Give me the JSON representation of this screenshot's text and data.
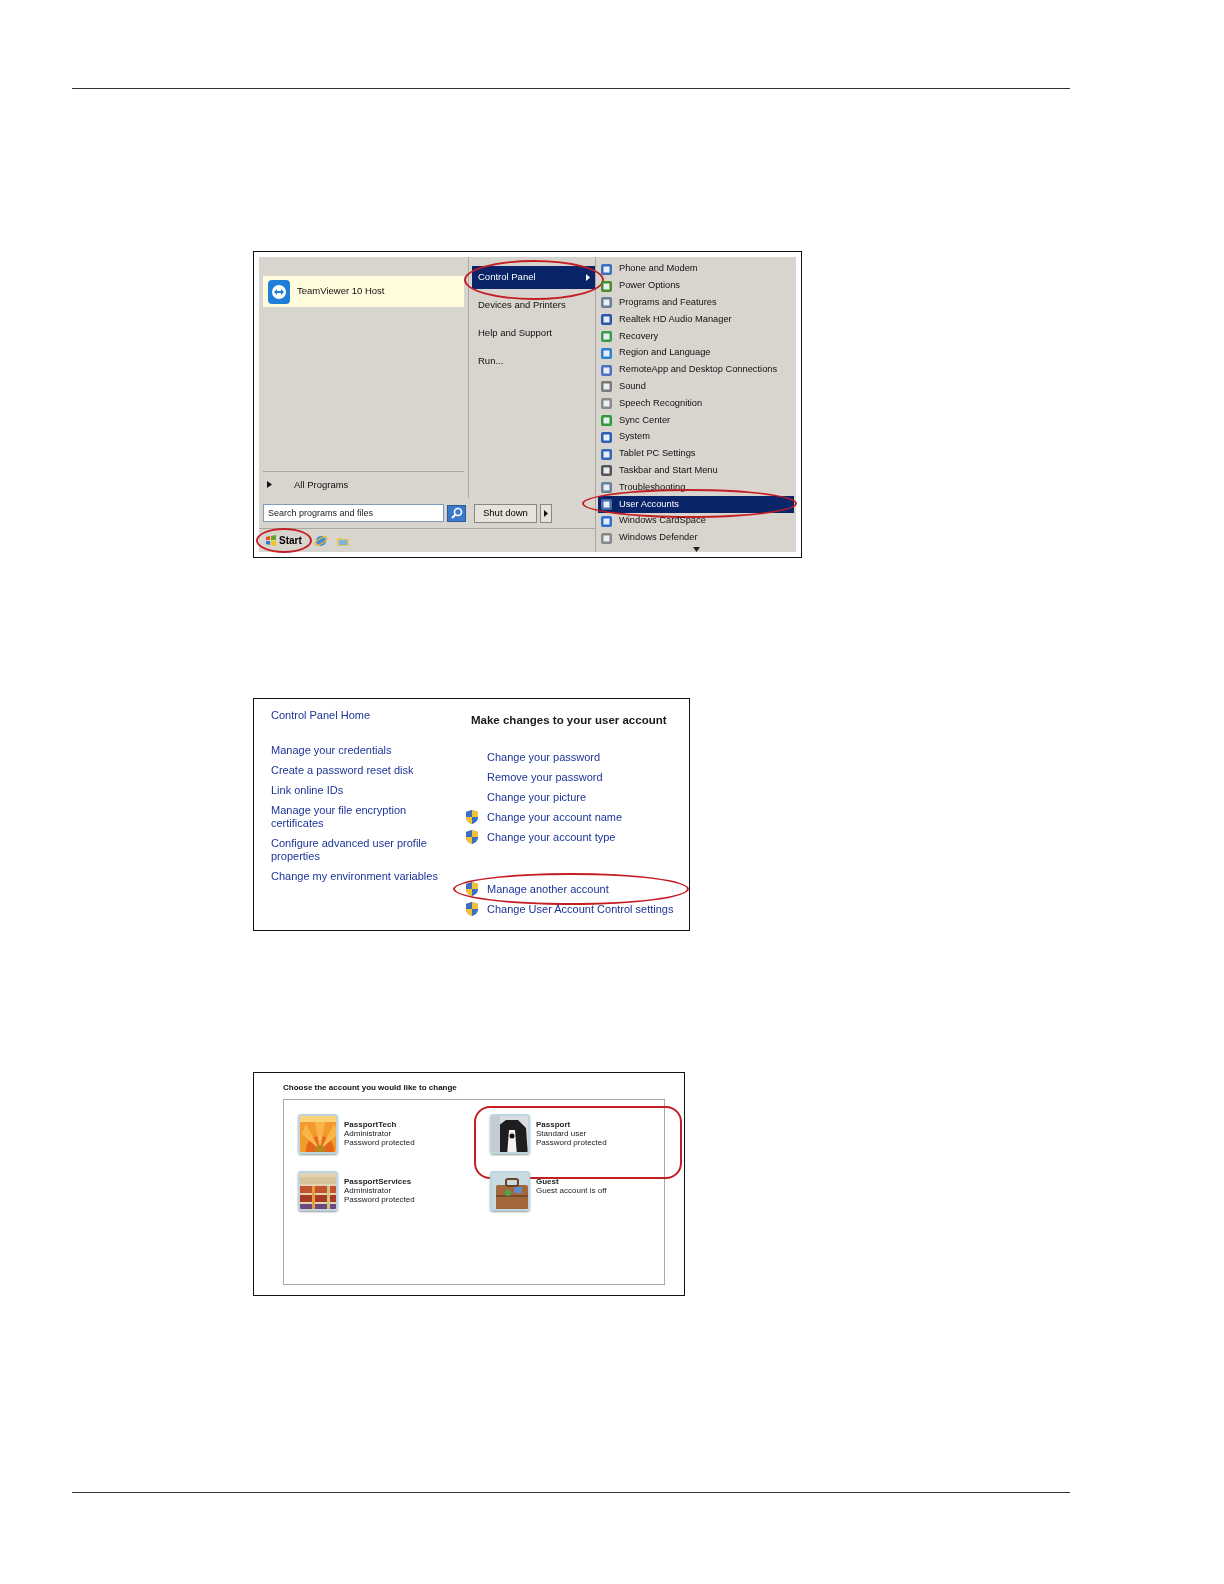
{
  "start_menu": {
    "pinned_programs": [
      {
        "label": "TeamViewer 10 Host"
      }
    ],
    "all_programs": "All Programs",
    "search": {
      "placeholder": "Search programs and files"
    },
    "shutdown": "Shut down",
    "places": [
      {
        "label": "Control Panel",
        "selected": true,
        "circled": true
      },
      {
        "label": "Devices and Printers",
        "selected": false,
        "circled": false
      },
      {
        "label": "Help and Support",
        "selected": false,
        "circled": false
      },
      {
        "label": "Run...",
        "selected": false,
        "circled": false
      }
    ],
    "submenu": [
      {
        "label": "Phone and Modem",
        "selected": false,
        "circled": false
      },
      {
        "label": "Power Options",
        "selected": false,
        "circled": false
      },
      {
        "label": "Programs and Features",
        "selected": false,
        "circled": false
      },
      {
        "label": "Realtek HD Audio Manager",
        "selected": false,
        "circled": false
      },
      {
        "label": "Recovery",
        "selected": false,
        "circled": false
      },
      {
        "label": "Region and Language",
        "selected": false,
        "circled": false
      },
      {
        "label": "RemoteApp and Desktop Connections",
        "selected": false,
        "circled": false
      },
      {
        "label": "Sound",
        "selected": false,
        "circled": false
      },
      {
        "label": "Speech Recognition",
        "selected": false,
        "circled": false
      },
      {
        "label": "Sync Center",
        "selected": false,
        "circled": false
      },
      {
        "label": "System",
        "selected": false,
        "circled": false
      },
      {
        "label": "Tablet PC Settings",
        "selected": false,
        "circled": false
      },
      {
        "label": "Taskbar and Start Menu",
        "selected": false,
        "circled": false
      },
      {
        "label": "Troubleshooting",
        "selected": false,
        "circled": false
      },
      {
        "label": "User Accounts",
        "selected": true,
        "circled": true
      },
      {
        "label": "Windows CardSpace",
        "selected": false,
        "circled": false
      },
      {
        "label": "Windows Defender",
        "selected": false,
        "circled": false
      }
    ],
    "taskbar": {
      "start": "Start",
      "circled": true
    }
  },
  "user_accounts": {
    "home_link": "Control Panel Home",
    "links": [
      "Manage your credentials",
      "Create a password reset disk",
      "Link online IDs",
      "Manage your file encryption certificates",
      "Configure advanced user profile properties",
      "Change my environment variables"
    ],
    "heading": "Make changes to your user account",
    "tasks": [
      {
        "label": "Change your password",
        "shield": false,
        "circled": false
      },
      {
        "label": "Remove your password",
        "shield": false,
        "circled": false
      },
      {
        "label": "Change your picture",
        "shield": false,
        "circled": false
      },
      {
        "label": "Change your account name",
        "shield": true,
        "circled": false
      },
      {
        "label": "Change your account type",
        "shield": true,
        "circled": false
      }
    ],
    "other_tasks": [
      {
        "label": "Manage another account",
        "shield": true,
        "circled": true
      },
      {
        "label": "Change User Account Control settings",
        "shield": true,
        "circled": false
      }
    ]
  },
  "manage_accounts": {
    "title": "Choose the account you would like to change",
    "accounts": [
      {
        "name": "PassportTech",
        "details": [
          "Administrator",
          "Password protected"
        ],
        "circled": false
      },
      {
        "name": "Passport",
        "details": [
          "Standard user",
          "Password protected"
        ],
        "circled": true
      },
      {
        "name": "PassportServices",
        "details": [
          "Administrator",
          "Password protected"
        ],
        "circled": false
      },
      {
        "name": "Guest",
        "details": [
          "Guest account is off"
        ],
        "circled": false
      }
    ]
  }
}
